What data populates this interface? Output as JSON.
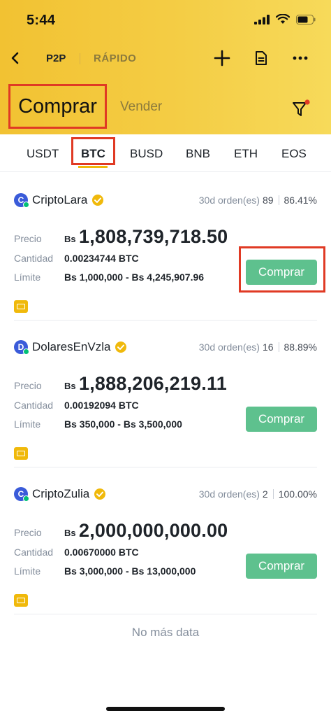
{
  "status_bar": {
    "time": "5:44"
  },
  "nav": {
    "p2p": "P2P",
    "rapido": "RÁPIDO"
  },
  "trade_tabs": {
    "buy": "Comprar",
    "sell": "Vender"
  },
  "coins": [
    "USDT",
    "BTC",
    "BUSD",
    "BNB",
    "ETH",
    "EOS"
  ],
  "active_coin": "BTC",
  "labels": {
    "price": "Precio",
    "quantity": "Cantidad",
    "limit": "Límite",
    "buy_button": "Comprar"
  },
  "offers": [
    {
      "avatar_letter": "C",
      "avatar_color": "#3a5bd9",
      "merchant": "CriptoLara",
      "orders_label": "30d orden(es)",
      "orders": "89",
      "completion": "86.41%",
      "currency": "Bs",
      "price": "1,808,739,718.50",
      "quantity": "0.00234744 BTC",
      "limit": "Bs 1,000,000 - Bs 4,245,907.96"
    },
    {
      "avatar_letter": "D",
      "avatar_color": "#3a5bd9",
      "merchant": "DolaresEnVzla",
      "orders_label": "30d orden(es)",
      "orders": "16",
      "completion": "88.89%",
      "currency": "Bs",
      "price": "1,888,206,219.11",
      "quantity": "0.00192094 BTC",
      "limit": "Bs 350,000 - Bs 3,500,000"
    },
    {
      "avatar_letter": "C",
      "avatar_color": "#3a5bd9",
      "merchant": "CriptoZulia",
      "orders_label": "30d orden(es)",
      "orders": "2",
      "completion": "100.00%",
      "currency": "Bs",
      "price": "2,000,000,000.00",
      "quantity": "0.00670000 BTC",
      "limit": "Bs 3,000,000 - Bs 13,000,000"
    }
  ],
  "footer": {
    "no_more": "No más data"
  },
  "colors": {
    "header": "#f3c93f",
    "buy_button": "#5ec18e",
    "highlight": "#e03a24",
    "accent": "#f0b90b"
  }
}
